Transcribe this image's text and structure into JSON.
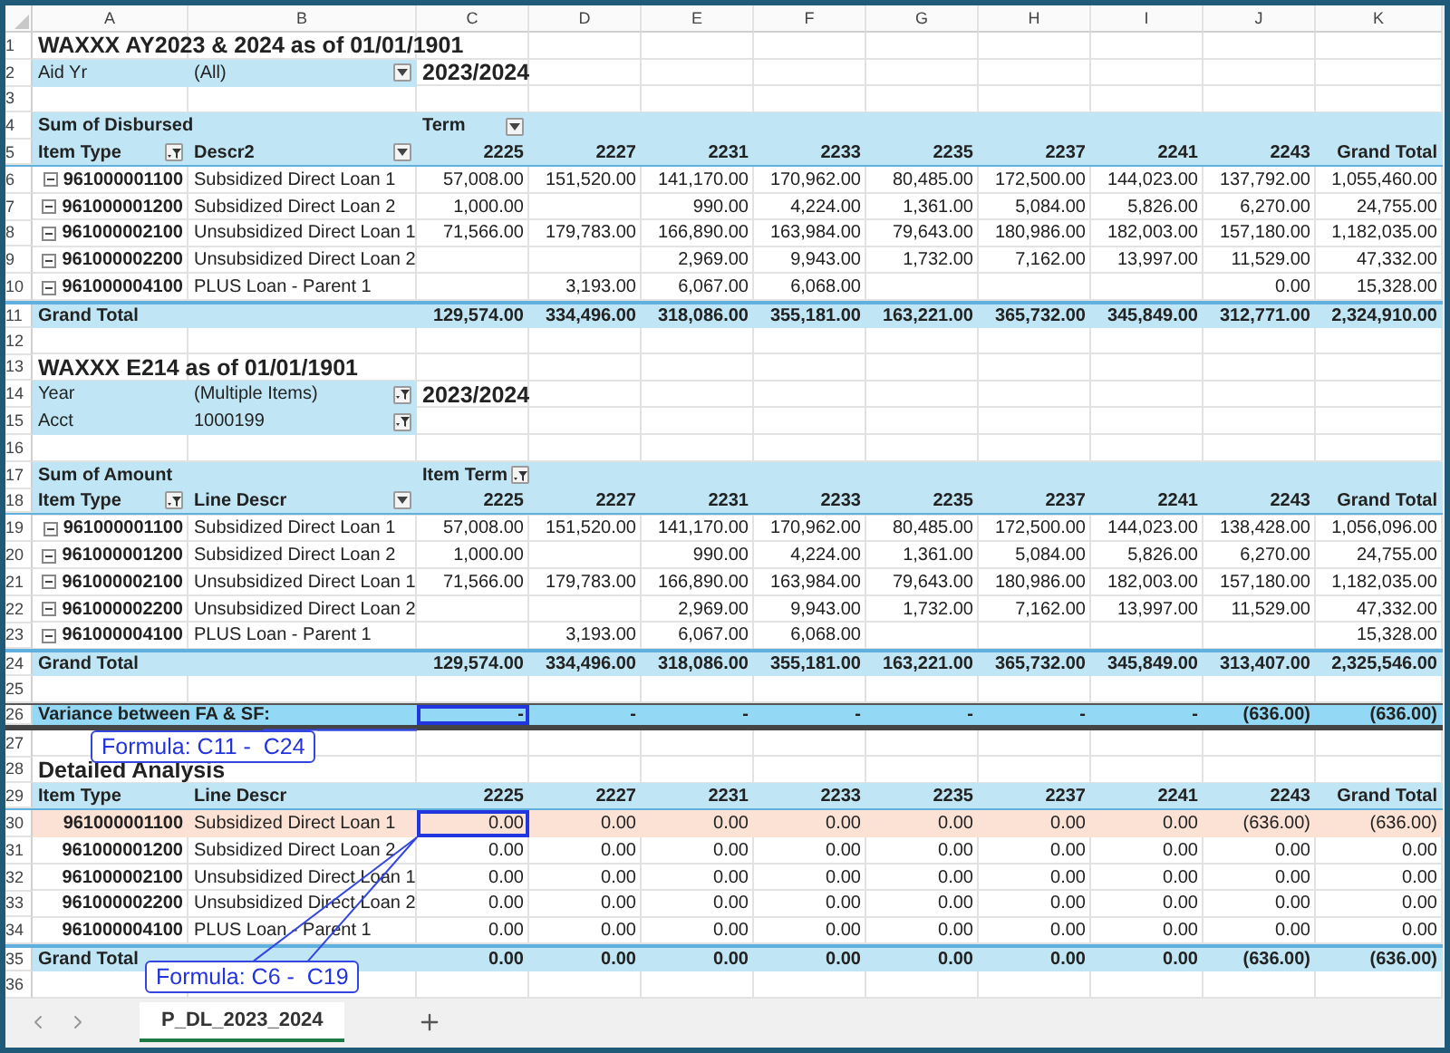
{
  "columns": [
    "A",
    "B",
    "C",
    "D",
    "E",
    "F",
    "G",
    "H",
    "I",
    "J",
    "K"
  ],
  "rows": [
    {
      "kind": "title",
      "number": "1",
      "text": "WAXXX AY2023 & 2024 as of 01/01/1901"
    },
    {
      "kind": "filter",
      "number": "2",
      "label": "Aid Yr",
      "value": "(All)",
      "filtered": false,
      "note": "2023/2024"
    },
    {
      "kind": "blank",
      "number": "3"
    },
    {
      "kind": "caption",
      "number": "4",
      "label": "Sum of Disbursed",
      "field": "Term",
      "filtered": false
    },
    {
      "kind": "header",
      "number": "5",
      "item_label": "Item Type",
      "item_filtered": true,
      "descr_label": "Descr2",
      "descr_filtered": false,
      "values": [
        "2225",
        "2227",
        "2231",
        "2233",
        "2235",
        "2237",
        "2241",
        "2243",
        "Grand Total"
      ]
    },
    {
      "kind": "data",
      "number": "6",
      "expanded": true,
      "highlighted": false,
      "code": "961000001100",
      "descr": "Subsidized Direct Loan 1",
      "values": [
        {
          "kind": "amount",
          "text": "57,008.00"
        },
        {
          "kind": "amount",
          "text": "151,520.00"
        },
        {
          "kind": "amount",
          "text": "141,170.00"
        },
        {
          "kind": "amount",
          "text": "170,962.00"
        },
        {
          "kind": "amount",
          "text": "80,485.00"
        },
        {
          "kind": "amount",
          "text": "172,500.00"
        },
        {
          "kind": "amount",
          "text": "144,023.00"
        },
        {
          "kind": "amount",
          "text": "137,792.00"
        },
        {
          "kind": "amount",
          "text": "1,055,460.00"
        }
      ]
    },
    {
      "kind": "data",
      "number": "7",
      "expanded": true,
      "highlighted": false,
      "code": "961000001200",
      "descr": "Subsidized Direct Loan 2",
      "values": [
        {
          "kind": "amount",
          "text": "1,000.00"
        },
        {
          "kind": "empty"
        },
        {
          "kind": "amount",
          "text": "990.00"
        },
        {
          "kind": "amount",
          "text": "4,224.00"
        },
        {
          "kind": "amount",
          "text": "1,361.00"
        },
        {
          "kind": "amount",
          "text": "5,084.00"
        },
        {
          "kind": "amount",
          "text": "5,826.00"
        },
        {
          "kind": "amount",
          "text": "6,270.00"
        },
        {
          "kind": "amount",
          "text": "24,755.00"
        }
      ]
    },
    {
      "kind": "data",
      "number": "8",
      "expanded": true,
      "highlighted": false,
      "code": "961000002100",
      "descr": "Unsubsidized Direct Loan 1",
      "values": [
        {
          "kind": "amount",
          "text": "71,566.00"
        },
        {
          "kind": "amount",
          "text": "179,783.00"
        },
        {
          "kind": "amount",
          "text": "166,890.00"
        },
        {
          "kind": "amount",
          "text": "163,984.00"
        },
        {
          "kind": "amount",
          "text": "79,643.00"
        },
        {
          "kind": "amount",
          "text": "180,986.00"
        },
        {
          "kind": "amount",
          "text": "182,003.00"
        },
        {
          "kind": "amount",
          "text": "157,180.00"
        },
        {
          "kind": "amount",
          "text": "1,182,035.00"
        }
      ]
    },
    {
      "kind": "data",
      "number": "9",
      "expanded": true,
      "highlighted": false,
      "code": "961000002200",
      "descr": "Unsubsidized Direct Loan 2",
      "values": [
        {
          "kind": "empty"
        },
        {
          "kind": "empty"
        },
        {
          "kind": "amount",
          "text": "2,969.00"
        },
        {
          "kind": "amount",
          "text": "9,943.00"
        },
        {
          "kind": "amount",
          "text": "1,732.00"
        },
        {
          "kind": "amount",
          "text": "7,162.00"
        },
        {
          "kind": "amount",
          "text": "13,997.00"
        },
        {
          "kind": "amount",
          "text": "11,529.00"
        },
        {
          "kind": "amount",
          "text": "47,332.00"
        }
      ]
    },
    {
      "kind": "data",
      "number": "10",
      "expanded": true,
      "highlighted": false,
      "code": "961000004100",
      "descr": "PLUS Loan - Parent 1",
      "values": [
        {
          "kind": "empty"
        },
        {
          "kind": "amount",
          "text": "3,193.00"
        },
        {
          "kind": "amount",
          "text": "6,067.00"
        },
        {
          "kind": "amount",
          "text": "6,068.00"
        },
        {
          "kind": "empty"
        },
        {
          "kind": "empty"
        },
        {
          "kind": "empty"
        },
        {
          "kind": "amount",
          "text": "0.00"
        },
        {
          "kind": "amount",
          "text": "15,328.00"
        }
      ]
    },
    {
      "kind": "total",
      "number": "11",
      "label": "Grand Total",
      "values": [
        {
          "kind": "amount",
          "text": "129,574.00"
        },
        {
          "kind": "amount",
          "text": "334,496.00"
        },
        {
          "kind": "amount",
          "text": "318,086.00"
        },
        {
          "kind": "amount",
          "text": "355,181.00"
        },
        {
          "kind": "amount",
          "text": "163,221.00"
        },
        {
          "kind": "amount",
          "text": "365,732.00"
        },
        {
          "kind": "amount",
          "text": "345,849.00"
        },
        {
          "kind": "amount",
          "text": "312,771.00"
        },
        {
          "kind": "amount",
          "text": "2,324,910.00"
        }
      ]
    },
    {
      "kind": "blank",
      "number": "12"
    },
    {
      "kind": "title",
      "number": "13",
      "text": "WAXXX E214 as of 01/01/1901"
    },
    {
      "kind": "filter",
      "number": "14",
      "label": "Year",
      "value": "(Multiple Items)",
      "filtered": true,
      "note": "2023/2024"
    },
    {
      "kind": "filter",
      "number": "15",
      "label": "Acct",
      "value": "1000199",
      "filtered": true
    },
    {
      "kind": "blank",
      "number": "16"
    },
    {
      "kind": "caption",
      "number": "17",
      "label": "Sum of Amount",
      "field": "Item Term",
      "filtered": true
    },
    {
      "kind": "header",
      "number": "18",
      "item_label": "Item Type",
      "item_filtered": true,
      "descr_label": "Line Descr",
      "descr_filtered": false,
      "values": [
        "2225",
        "2227",
        "2231",
        "2233",
        "2235",
        "2237",
        "2241",
        "2243",
        "Grand Total"
      ]
    },
    {
      "kind": "data",
      "number": "19",
      "expanded": true,
      "highlighted": false,
      "code": "961000001100",
      "descr": "Subsidized Direct Loan 1",
      "values": [
        {
          "kind": "amount",
          "text": "57,008.00"
        },
        {
          "kind": "amount",
          "text": "151,520.00"
        },
        {
          "kind": "amount",
          "text": "141,170.00"
        },
        {
          "kind": "amount",
          "text": "170,962.00"
        },
        {
          "kind": "amount",
          "text": "80,485.00"
        },
        {
          "kind": "amount",
          "text": "172,500.00"
        },
        {
          "kind": "amount",
          "text": "144,023.00"
        },
        {
          "kind": "amount",
          "text": "138,428.00"
        },
        {
          "kind": "amount",
          "text": "1,056,096.00"
        }
      ]
    },
    {
      "kind": "data",
      "number": "20",
      "expanded": true,
      "highlighted": false,
      "code": "961000001200",
      "descr": "Subsidized Direct Loan 2",
      "values": [
        {
          "kind": "amount",
          "text": "1,000.00"
        },
        {
          "kind": "empty"
        },
        {
          "kind": "amount",
          "text": "990.00"
        },
        {
          "kind": "amount",
          "text": "4,224.00"
        },
        {
          "kind": "amount",
          "text": "1,361.00"
        },
        {
          "kind": "amount",
          "text": "5,084.00"
        },
        {
          "kind": "amount",
          "text": "5,826.00"
        },
        {
          "kind": "amount",
          "text": "6,270.00"
        },
        {
          "kind": "amount",
          "text": "24,755.00"
        }
      ]
    },
    {
      "kind": "data",
      "number": "21",
      "expanded": true,
      "highlighted": false,
      "code": "961000002100",
      "descr": "Unsubsidized Direct Loan 1",
      "values": [
        {
          "kind": "amount",
          "text": "71,566.00"
        },
        {
          "kind": "amount",
          "text": "179,783.00"
        },
        {
          "kind": "amount",
          "text": "166,890.00"
        },
        {
          "kind": "amount",
          "text": "163,984.00"
        },
        {
          "kind": "amount",
          "text": "79,643.00"
        },
        {
          "kind": "amount",
          "text": "180,986.00"
        },
        {
          "kind": "amount",
          "text": "182,003.00"
        },
        {
          "kind": "amount",
          "text": "157,180.00"
        },
        {
          "kind": "amount",
          "text": "1,182,035.00"
        }
      ]
    },
    {
      "kind": "data",
      "number": "22",
      "expanded": true,
      "highlighted": false,
      "code": "961000002200",
      "descr": "Unsubsidized Direct Loan 2",
      "values": [
        {
          "kind": "empty"
        },
        {
          "kind": "empty"
        },
        {
          "kind": "amount",
          "text": "2,969.00"
        },
        {
          "kind": "amount",
          "text": "9,943.00"
        },
        {
          "kind": "amount",
          "text": "1,732.00"
        },
        {
          "kind": "amount",
          "text": "7,162.00"
        },
        {
          "kind": "amount",
          "text": "13,997.00"
        },
        {
          "kind": "amount",
          "text": "11,529.00"
        },
        {
          "kind": "amount",
          "text": "47,332.00"
        }
      ]
    },
    {
      "kind": "data",
      "number": "23",
      "expanded": true,
      "highlighted": false,
      "code": "961000004100",
      "descr": "PLUS Loan - Parent 1",
      "values": [
        {
          "kind": "empty"
        },
        {
          "kind": "amount",
          "text": "3,193.00"
        },
        {
          "kind": "amount",
          "text": "6,067.00"
        },
        {
          "kind": "amount",
          "text": "6,068.00"
        },
        {
          "kind": "empty"
        },
        {
          "kind": "empty"
        },
        {
          "kind": "empty"
        },
        {
          "kind": "empty"
        },
        {
          "kind": "amount",
          "text": "15,328.00"
        }
      ]
    },
    {
      "kind": "total",
      "number": "24",
      "label": "Grand Total",
      "values": [
        {
          "kind": "amount",
          "text": "129,574.00"
        },
        {
          "kind": "amount",
          "text": "334,496.00"
        },
        {
          "kind": "amount",
          "text": "318,086.00"
        },
        {
          "kind": "amount",
          "text": "355,181.00"
        },
        {
          "kind": "amount",
          "text": "163,221.00"
        },
        {
          "kind": "amount",
          "text": "365,732.00"
        },
        {
          "kind": "amount",
          "text": "345,849.00"
        },
        {
          "kind": "amount",
          "text": "313,407.00"
        },
        {
          "kind": "amount",
          "text": "2,325,546.00"
        }
      ]
    },
    {
      "kind": "blank",
      "number": "25"
    },
    {
      "kind": "variance",
      "number": "26",
      "label": "Variance between FA & SF:",
      "values": [
        {
          "kind": "amount",
          "text": "-"
        },
        {
          "kind": "amount",
          "text": "-"
        },
        {
          "kind": "amount",
          "text": "-"
        },
        {
          "kind": "amount",
          "text": "-"
        },
        {
          "kind": "amount",
          "text": "-"
        },
        {
          "kind": "amount",
          "text": "-"
        },
        {
          "kind": "amount",
          "text": "-"
        },
        {
          "kind": "amount",
          "text": "(636.00)"
        },
        {
          "kind": "amount",
          "text": "(636.00)"
        }
      ],
      "callout": "Formula: C11 -  C24"
    },
    {
      "kind": "blank",
      "number": "27"
    },
    {
      "kind": "title",
      "number": "28",
      "text": "Detailed Analysis"
    },
    {
      "kind": "header",
      "number": "29",
      "item_label": "Item Type",
      "descr_label": "Line Descr",
      "values": [
        "2225",
        "2227",
        "2231",
        "2233",
        "2235",
        "2237",
        "2241",
        "2243",
        "Grand Total"
      ]
    },
    {
      "kind": "data",
      "number": "30",
      "highlighted": true,
      "code": "961000001100",
      "descr": "Subsidized Direct Loan 1",
      "values": [
        {
          "kind": "amount",
          "text": "0.00"
        },
        {
          "kind": "amount",
          "text": "0.00"
        },
        {
          "kind": "amount",
          "text": "0.00"
        },
        {
          "kind": "amount",
          "text": "0.00"
        },
        {
          "kind": "amount",
          "text": "0.00"
        },
        {
          "kind": "amount",
          "text": "0.00"
        },
        {
          "kind": "amount",
          "text": "0.00"
        },
        {
          "kind": "amount",
          "text": "(636.00)"
        },
        {
          "kind": "amount",
          "text": "(636.00)"
        }
      ],
      "callout": "Formula: C6 -  C19"
    },
    {
      "kind": "data",
      "number": "31",
      "highlighted": false,
      "code": "961000001200",
      "descr": "Subsidized Direct Loan 2",
      "values": [
        {
          "kind": "amount",
          "text": "0.00"
        },
        {
          "kind": "amount",
          "text": "0.00"
        },
        {
          "kind": "amount",
          "text": "0.00"
        },
        {
          "kind": "amount",
          "text": "0.00"
        },
        {
          "kind": "amount",
          "text": "0.00"
        },
        {
          "kind": "amount",
          "text": "0.00"
        },
        {
          "kind": "amount",
          "text": "0.00"
        },
        {
          "kind": "amount",
          "text": "0.00"
        },
        {
          "kind": "amount",
          "text": "0.00"
        }
      ]
    },
    {
      "kind": "data",
      "number": "32",
      "highlighted": false,
      "code": "961000002100",
      "descr": "Unsubsidized Direct Loan 1",
      "values": [
        {
          "kind": "amount",
          "text": "0.00"
        },
        {
          "kind": "amount",
          "text": "0.00"
        },
        {
          "kind": "amount",
          "text": "0.00"
        },
        {
          "kind": "amount",
          "text": "0.00"
        },
        {
          "kind": "amount",
          "text": "0.00"
        },
        {
          "kind": "amount",
          "text": "0.00"
        },
        {
          "kind": "amount",
          "text": "0.00"
        },
        {
          "kind": "amount",
          "text": "0.00"
        },
        {
          "kind": "amount",
          "text": "0.00"
        }
      ]
    },
    {
      "kind": "data",
      "number": "33",
      "highlighted": false,
      "code": "961000002200",
      "descr": "Unsubsidized Direct Loan 2",
      "values": [
        {
          "kind": "amount",
          "text": "0.00"
        },
        {
          "kind": "amount",
          "text": "0.00"
        },
        {
          "kind": "amount",
          "text": "0.00"
        },
        {
          "kind": "amount",
          "text": "0.00"
        },
        {
          "kind": "amount",
          "text": "0.00"
        },
        {
          "kind": "amount",
          "text": "0.00"
        },
        {
          "kind": "amount",
          "text": "0.00"
        },
        {
          "kind": "amount",
          "text": "0.00"
        },
        {
          "kind": "amount",
          "text": "0.00"
        }
      ]
    },
    {
      "kind": "data",
      "number": "34",
      "highlighted": false,
      "code": "961000004100",
      "descr": "PLUS Loan - Parent 1",
      "values": [
        {
          "kind": "amount",
          "text": "0.00"
        },
        {
          "kind": "amount",
          "text": "0.00"
        },
        {
          "kind": "amount",
          "text": "0.00"
        },
        {
          "kind": "amount",
          "text": "0.00"
        },
        {
          "kind": "amount",
          "text": "0.00"
        },
        {
          "kind": "amount",
          "text": "0.00"
        },
        {
          "kind": "amount",
          "text": "0.00"
        },
        {
          "kind": "amount",
          "text": "0.00"
        },
        {
          "kind": "amount",
          "text": "0.00"
        }
      ]
    },
    {
      "kind": "total",
      "number": "35",
      "label": "Grand Total",
      "values": [
        {
          "kind": "amount",
          "text": "0.00"
        },
        {
          "kind": "amount",
          "text": "0.00"
        },
        {
          "kind": "amount",
          "text": "0.00"
        },
        {
          "kind": "amount",
          "text": "0.00"
        },
        {
          "kind": "amount",
          "text": "0.00"
        },
        {
          "kind": "amount",
          "text": "0.00"
        },
        {
          "kind": "amount",
          "text": "0.00"
        },
        {
          "kind": "amount",
          "text": "(636.00)"
        },
        {
          "kind": "amount",
          "text": "(636.00)"
        }
      ]
    },
    {
      "kind": "blank",
      "number": "36"
    }
  ],
  "sheet_tabs": [
    {
      "label": "P_DL_2023_2024",
      "selected": true
    }
  ]
}
